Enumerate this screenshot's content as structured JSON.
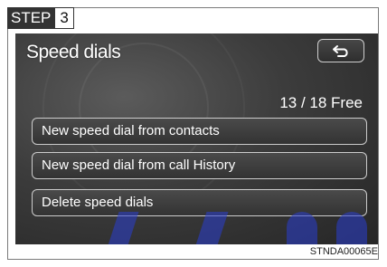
{
  "step": {
    "label": "STEP",
    "number": "3"
  },
  "screen": {
    "title": "Speed dials",
    "back_button_icon": "back-arrow-icon",
    "free_count": "13 / 18 Free",
    "buttons": [
      {
        "label": "New speed dial from contacts"
      },
      {
        "label": "New speed dial from call History"
      },
      {
        "label": "Delete speed dials"
      }
    ]
  },
  "figure_code": "STNDA00065E",
  "colors": {
    "screen_background": "#3c3c3c",
    "button_border": "#cccccc",
    "text": "#ffffff",
    "watermark": "#2a3ed0"
  }
}
